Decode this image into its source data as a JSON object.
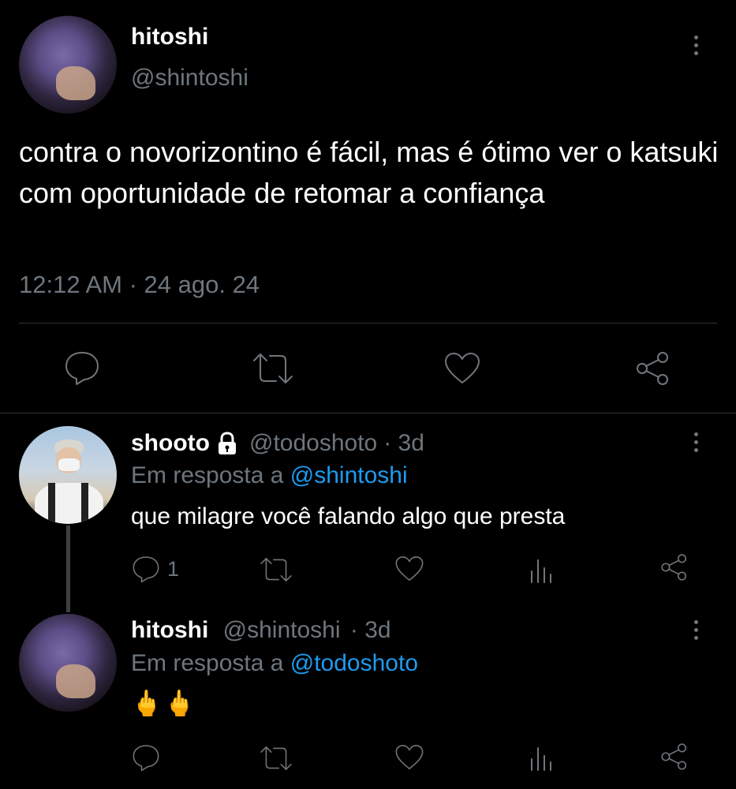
{
  "main_tweet": {
    "display_name": "hitoshi",
    "handle": "@shintoshi",
    "text": "contra o novorizontino é fácil, mas é ótimo ver o katsuki com oportunidade de retomar a confiança",
    "timestamp": "12:12 AM · 24 ago. 24",
    "actions": [
      "reply-icon",
      "retweet-icon",
      "like-icon",
      "share-icon"
    ]
  },
  "replies": [
    {
      "display_name": "shooto",
      "locked": true,
      "handle": "@todoshoto",
      "time": "· 3d",
      "reply_prefix": "Em resposta a",
      "reply_to": "@shintoshi",
      "text": "que milagre você falando algo que presta",
      "reply_count": "1"
    },
    {
      "display_name": "hitoshi",
      "handle": "@shintoshi",
      "time": "· 3d",
      "reply_prefix": "Em resposta a",
      "reply_to": "@todoshoto",
      "text": "🖕🖕",
      "reply_count": ""
    }
  ],
  "colors": {
    "background": "#000000",
    "text": "#e7e9ea",
    "muted": "#6e767d",
    "link": "#1d9bf0",
    "divider": "#2f3336"
  }
}
